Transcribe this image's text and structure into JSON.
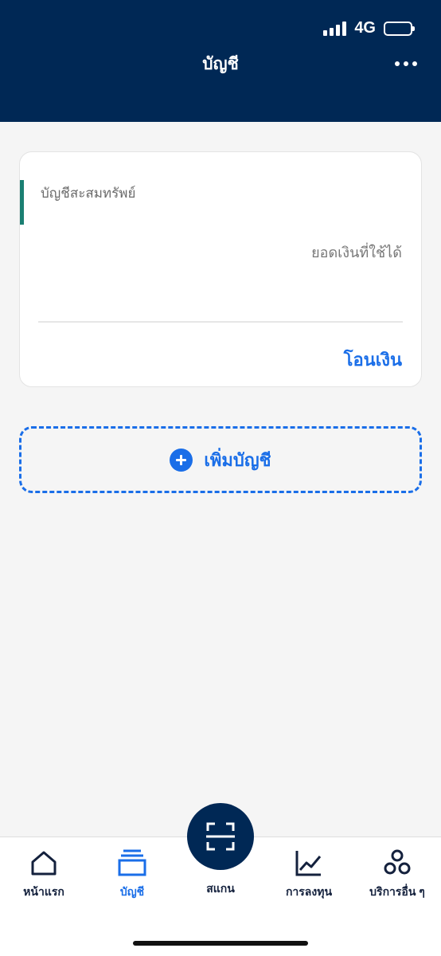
{
  "status_bar": {
    "network": "4G"
  },
  "header": {
    "title": "บัญชี",
    "more_icon": "more-horizontal-icon"
  },
  "account_card": {
    "name": "บัญชีสะสมทรัพย์",
    "available_label": "ยอดเงินที่ใช้ได้",
    "transfer_label": "โอนเงิน",
    "accent_color": "#1a7f72"
  },
  "add_account": {
    "label": "เพิ่มบัญชี",
    "icon": "plus-circle-icon"
  },
  "bottom_nav": {
    "items": [
      {
        "label": "หน้าแรก",
        "icon": "home-icon"
      },
      {
        "label": "บัญชี",
        "icon": "accounts-icon",
        "active": true
      },
      {
        "label": "สแกน",
        "icon": "scan-icon"
      },
      {
        "label": "การลงทุน",
        "icon": "investment-chart-icon"
      },
      {
        "label": "บริการอื่น ๆ",
        "icon": "other-services-icon"
      }
    ]
  },
  "colors": {
    "header": "#002855",
    "accent": "#1a6ee8",
    "background": "#f5f5f5"
  }
}
